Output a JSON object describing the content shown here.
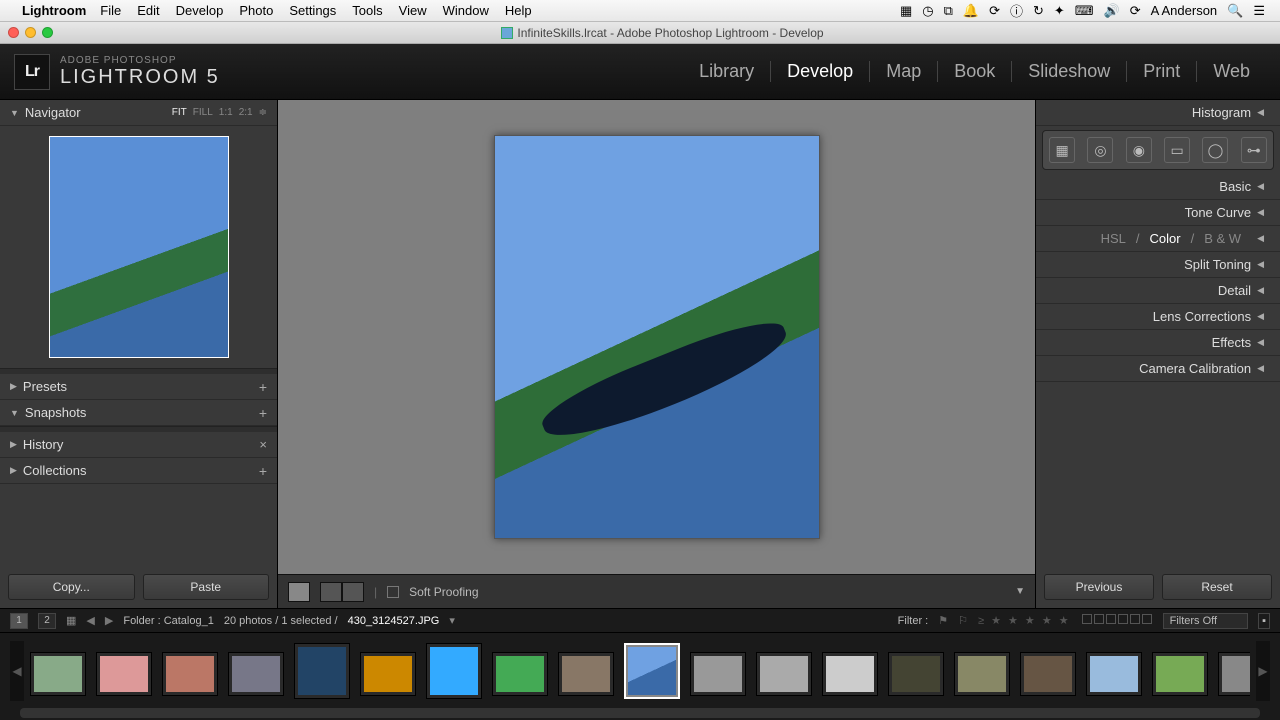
{
  "mac": {
    "app_name": "Lightroom",
    "menus": [
      "File",
      "Edit",
      "Develop",
      "Photo",
      "Settings",
      "Tools",
      "View",
      "Window",
      "Help"
    ],
    "user": "A Anderson"
  },
  "window": {
    "title": "InfiniteSkills.lrcat - Adobe Photoshop Lightroom - Develop"
  },
  "brand": {
    "sub": "ADOBE PHOTOSHOP",
    "main": "LIGHTROOM 5",
    "logo": "Lr"
  },
  "modules": [
    "Library",
    "Develop",
    "Map",
    "Book",
    "Slideshow",
    "Print",
    "Web"
  ],
  "active_module": "Develop",
  "left": {
    "navigator": {
      "label": "Navigator",
      "zoom": [
        "FIT",
        "FILL",
        "1:1",
        "2:1"
      ],
      "zoom_sel": "FIT"
    },
    "sections": [
      {
        "label": "Presets",
        "open": false,
        "action": "plus"
      },
      {
        "label": "Snapshots",
        "open": true,
        "action": "plus"
      },
      {
        "label": "History",
        "open": false,
        "action": "x"
      },
      {
        "label": "Collections",
        "open": false,
        "action": "plus"
      }
    ],
    "copy": "Copy...",
    "paste": "Paste"
  },
  "right": {
    "histogram": "Histogram",
    "sections": [
      "Basic",
      "Tone Curve",
      "Split Toning",
      "Detail",
      "Lens Corrections",
      "Effects",
      "Camera Calibration"
    ],
    "hsl": {
      "tabs": [
        "HSL",
        "Color",
        "B & W"
      ],
      "sel": "Color"
    },
    "prev": "Previous",
    "reset": "Reset"
  },
  "toolbar": {
    "soft_proof": "Soft Proofing"
  },
  "strip": {
    "pages": [
      "1",
      "2"
    ],
    "folder_label": "Folder : Catalog_1",
    "count": "20 photos / 1 selected /",
    "filename": "430_3124527.JPG",
    "filter_label": "Filter :",
    "filters_off": "Filters Off"
  },
  "thumbs": 19,
  "selected_thumb": 9
}
